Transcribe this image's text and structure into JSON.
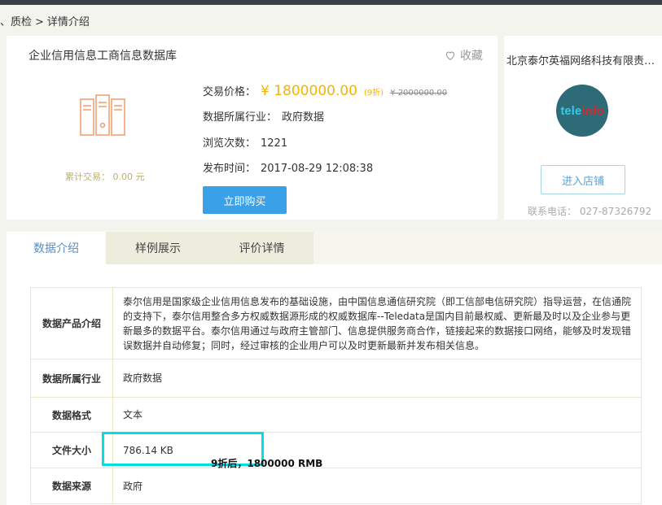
{
  "breadcrumb": {
    "prefix": "、质检",
    "sep": ">",
    "current": "详情介绍"
  },
  "product": {
    "title": "企业信用信息工商信息数据库",
    "favorite_label": "收藏",
    "trade_count_label": "累计交易： 0.00 元",
    "price_label": "交易价格：",
    "price": "¥ 1800000.00",
    "discount": "(9折)",
    "original_price": "¥ 2000000.00",
    "industry_label": "数据所属行业：",
    "industry": "政府数据",
    "views_label": "浏览次数：",
    "views": "1221",
    "publish_label": "发布时间：",
    "publish_time": "2017-08-29 12:08:38",
    "buy_button": "立即购买"
  },
  "shop": {
    "name": "北京泰尔英福网络科技有限责…",
    "logo_text_a": "tele",
    "logo_text_b": "info",
    "enter_button": "进入店铺",
    "phone": "联系电话：  027-87326792"
  },
  "tabs": [
    {
      "label": "数据介绍",
      "active": true
    },
    {
      "label": "样例展示",
      "active": false
    },
    {
      "label": "评价详情",
      "active": false
    }
  ],
  "details": [
    {
      "key": "数据产品介绍",
      "value": "泰尔信用是国家级企业信用信息发布的基础设施，由中国信息通信研究院（即工信部电信研究院）指导运营，在信通院的支持下，泰尔信用整合多方权威数据源形成的权威数据库--Teledata是国内目前最权威、更新最及时以及企业参与更新最多的数据平台。泰尔信用通过与政府主管部门、信息提供服务商合作，链接起来的数据接口网络，能够及时发现错误数据并自动修复；同时，经过审核的企业用户可以及时更新最新并发布相关信息。"
    },
    {
      "key": "数据所属行业",
      "value": "政府数据"
    },
    {
      "key": "数据格式",
      "value": "文本"
    },
    {
      "key": "文件大小",
      "value": "786.14 KB"
    },
    {
      "key": "数据来源",
      "value": "政府"
    }
  ],
  "overlay_note": "9折后，1800000 RMB",
  "colors": {
    "accent_blue": "#3aa0e8",
    "price_yellow": "#f5b400",
    "highlight": "#00e0e0"
  }
}
